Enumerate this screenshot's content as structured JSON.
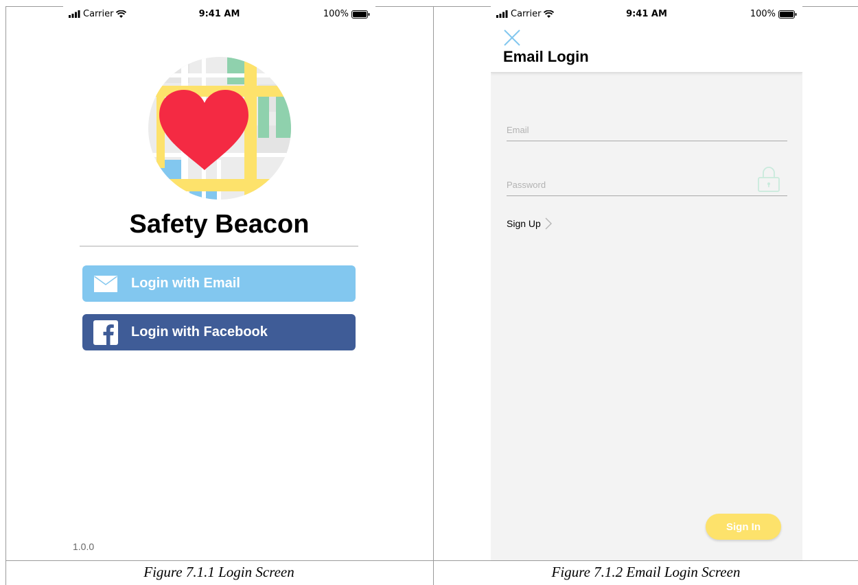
{
  "status_bar": {
    "carrier": "Carrier",
    "time": "9:41 AM",
    "battery": "100%"
  },
  "login_screen": {
    "app_title": "Safety Beacon",
    "email_button_label": "Login with Email",
    "facebook_button_label": "Login with Facebook",
    "version": "1.0.0"
  },
  "email_login_screen": {
    "title": "Email Login",
    "email_placeholder": "Email",
    "password_placeholder": "Password",
    "sign_up_label": "Sign Up",
    "sign_in_label": "Sign In"
  },
  "captions": {
    "left": "Figure 7.1.1 Login Screen",
    "right": "Figure 7.1.2 Email Login Screen"
  },
  "colors": {
    "email_button": "#82c7ef",
    "facebook_button": "#3f5c97",
    "sign_in_button": "#fde26b",
    "heart": "#f42a43"
  }
}
